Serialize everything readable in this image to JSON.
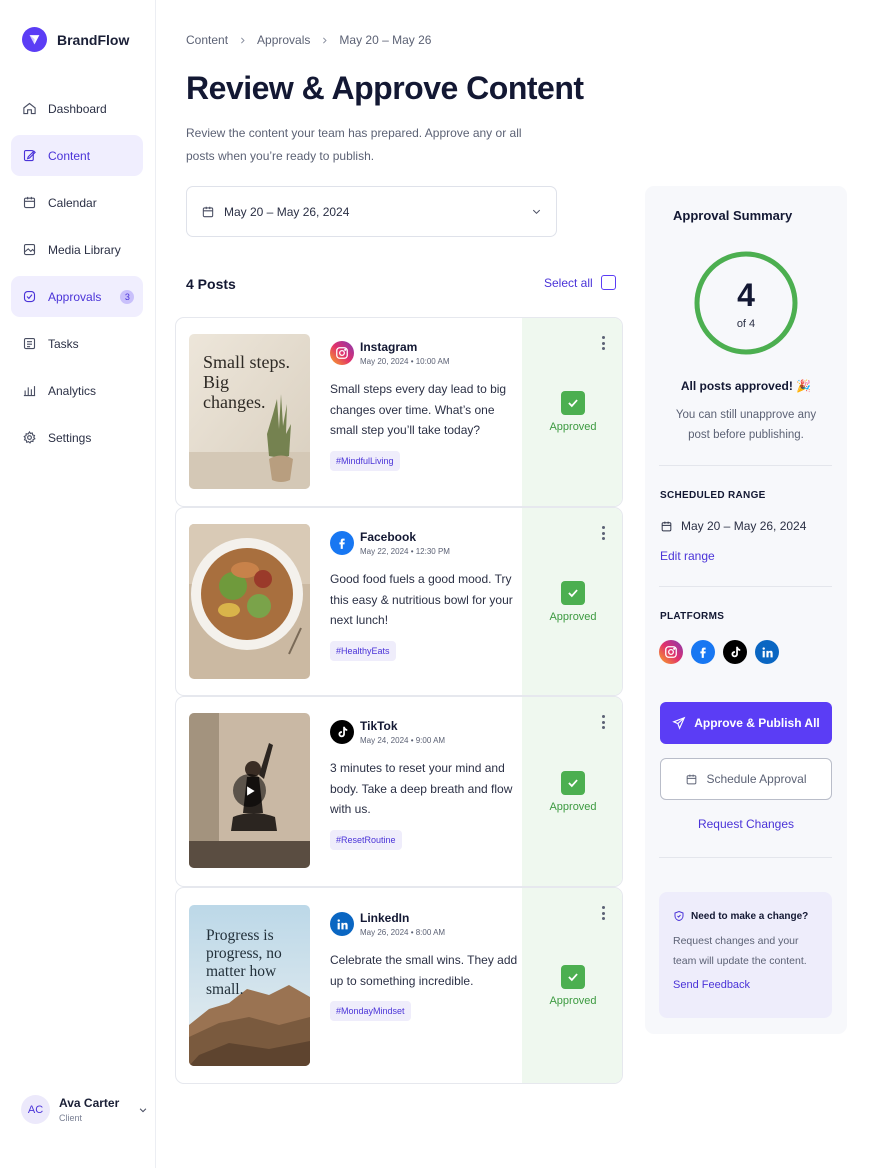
{
  "brand": {
    "name": "BrandFlow"
  },
  "nav": [
    {
      "label": "Dashboard",
      "icon": "home-icon"
    },
    {
      "label": "Content",
      "icon": "edit-icon",
      "active": true
    },
    {
      "label": "Calendar",
      "icon": "calendar-icon"
    },
    {
      "label": "Media Library",
      "icon": "image-icon"
    },
    {
      "label": "Approvals",
      "icon": "check-circle-icon",
      "active": true,
      "badge": "3"
    },
    {
      "label": "Tasks",
      "icon": "tasks-icon"
    },
    {
      "label": "Analytics",
      "icon": "bar-chart-icon"
    },
    {
      "label": "Settings",
      "icon": "gear-icon"
    }
  ],
  "user": {
    "initials": "AC",
    "name": "Ava Carter",
    "role": "Client"
  },
  "breadcrumb": [
    "Content",
    "Approvals",
    "May 20 – May 26"
  ],
  "page": {
    "title": "Review & Approve Content",
    "subtitle": "Review the content your team has prepared. Approve any or all posts when you’re ready to publish."
  },
  "date_select": {
    "value": "May 20 – May 26, 2024"
  },
  "posts_header": {
    "count_label": "4 Posts",
    "select_all": "Select all"
  },
  "posts": [
    {
      "platform": "Instagram",
      "meta": "May 20, 2024  •  10:00 AM",
      "text": "Small steps every day lead to big changes over time. What’s one small step you’ll take today?",
      "hashtag": "#MindfulLiving",
      "status": "Approved",
      "image_text": "Small steps. Big changes."
    },
    {
      "platform": "Facebook",
      "meta": "May 22, 2024  •  12:30 PM",
      "text": "Good food fuels a good mood. Try this easy & nutritious bowl for your next lunch!",
      "hashtag": "#HealthyEats",
      "status": "Approved"
    },
    {
      "platform": "TikTok",
      "meta": "May 24, 2024  •  9:00 AM",
      "text": "3 minutes to reset your mind and body. Take a deep breath and flow with us.",
      "hashtag": "#ResetRoutine",
      "status": "Approved"
    },
    {
      "platform": "LinkedIn",
      "meta": "May 26, 2024  •  8:00 AM",
      "text": "Celebrate the small wins. They add up to something incredible.",
      "hashtag": "#MondayMindset",
      "status": "Approved",
      "image_text": "Progress is progress, no matter how small."
    }
  ],
  "summary": {
    "title": "Approval Summary",
    "approved": 4,
    "total_label": "of 4",
    "approved_fraction": 1.0,
    "all_approved": "All posts approved! 🎉",
    "note": "You can still unapprove any post before publishing.",
    "scheduled_label": "SCHEDULED RANGE",
    "range": "May 20 – May 26, 2024",
    "edit_range": "Edit range",
    "platforms_label": "PLATFORMS",
    "primary_button": "Approve & Publish All",
    "secondary_button": "Schedule Approval",
    "request_changes": "Request Changes",
    "help": {
      "title": "Need to make a change?",
      "text": "Request changes and your team will update the content.",
      "link": "Send Feedback"
    }
  },
  "colors": {
    "accent": "#5b3df5",
    "approved": "#4caf50",
    "approved_bg": "#eff8ef"
  }
}
